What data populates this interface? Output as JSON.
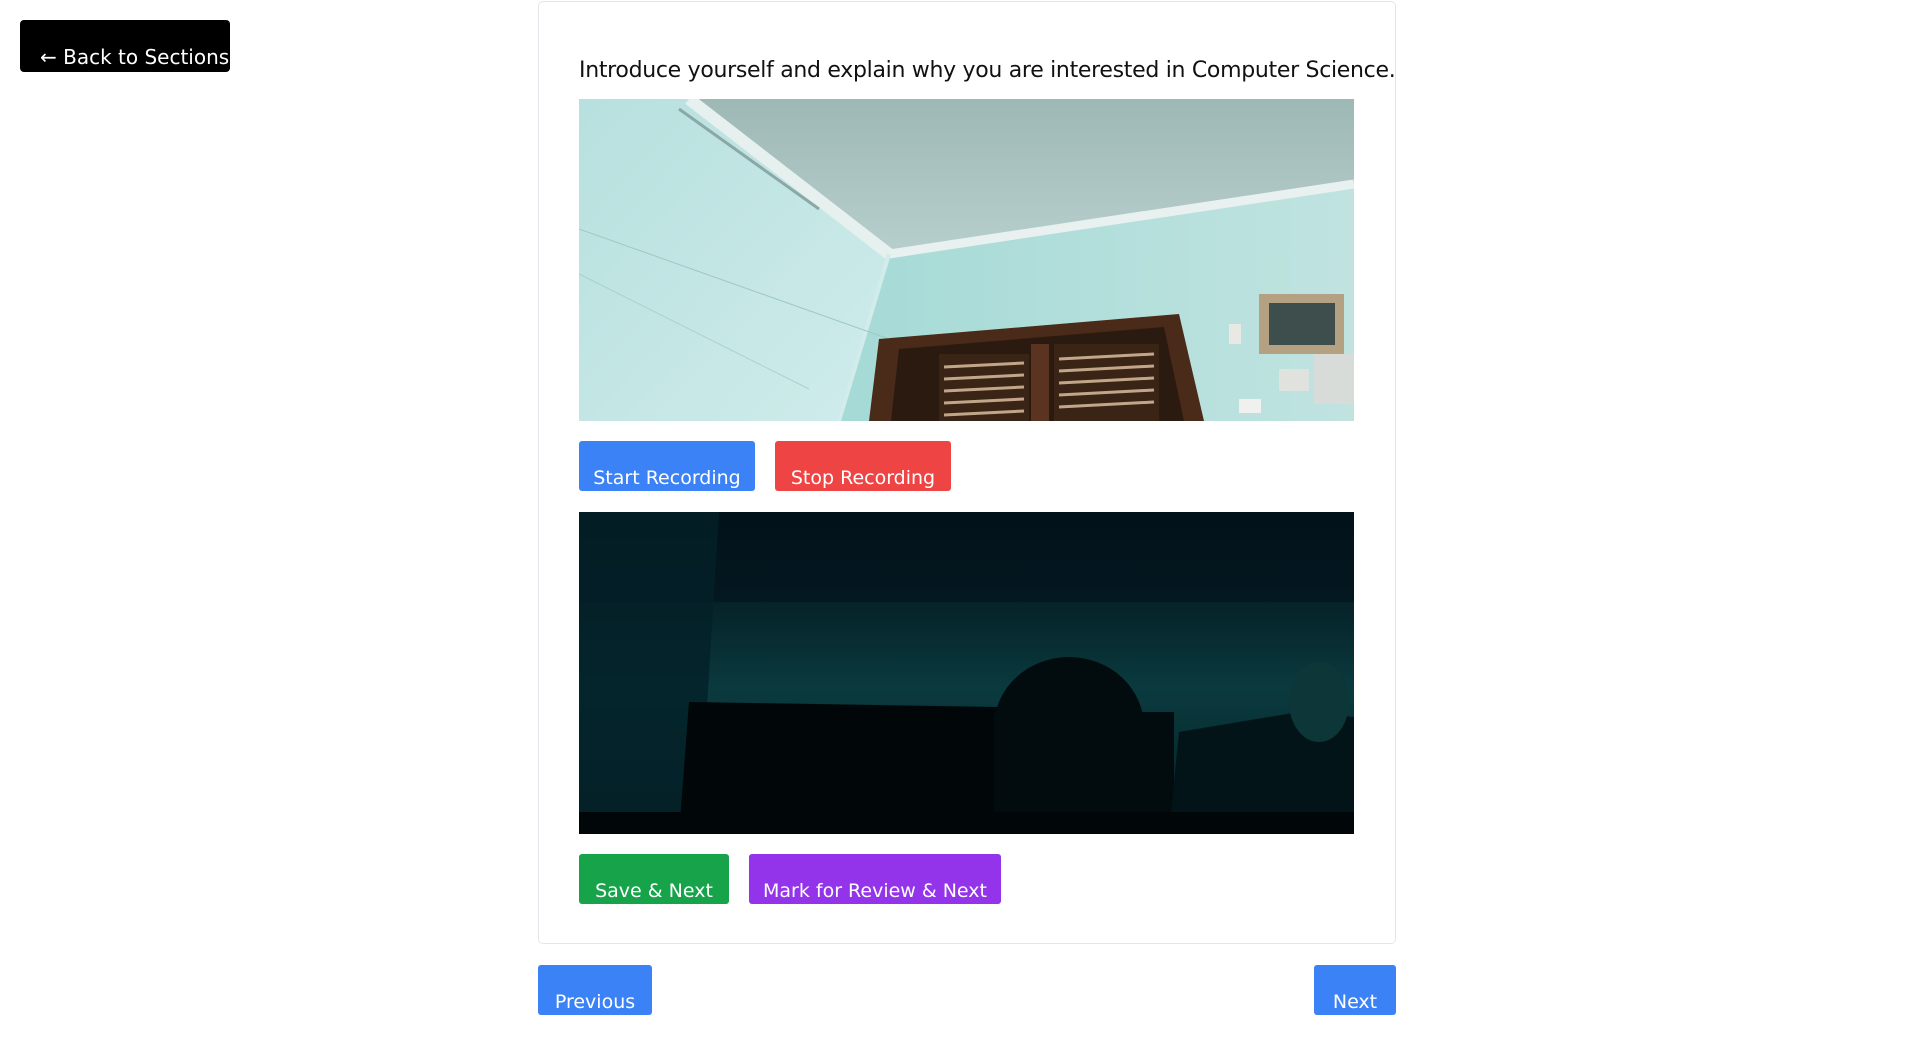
{
  "nav": {
    "back_label": "← Back to Sections",
    "previous_label": "Previous",
    "next_label": "Next"
  },
  "question": {
    "text": "Introduce yourself and explain why you are interested in Computer Science."
  },
  "recording": {
    "start_label": "Start Recording",
    "stop_label": "Stop Recording"
  },
  "actions": {
    "save_next_label": "Save & Next",
    "mark_review_label": "Mark for Review & Next"
  },
  "colors": {
    "back_button": "#000000",
    "start_button": "#3b82f6",
    "stop_button": "#ef4444",
    "save_button": "#16a34a",
    "mark_button": "#9333ea",
    "nav_button": "#3b82f6"
  }
}
